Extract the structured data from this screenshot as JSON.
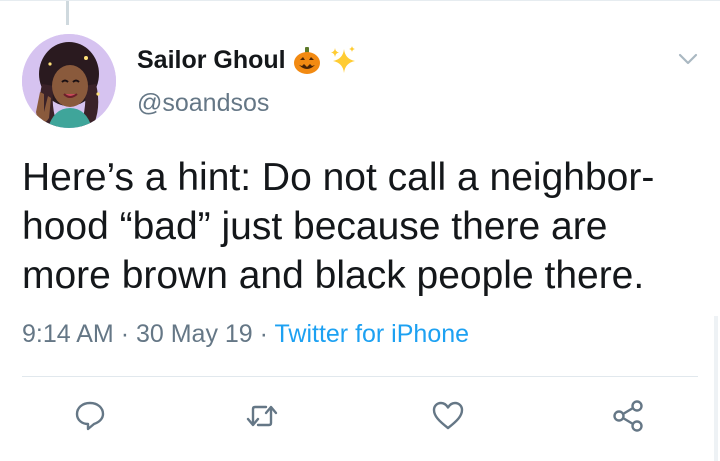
{
  "tweet": {
    "display_name": "Sailor Ghoul",
    "name_emojis": [
      "jack-o-lantern",
      "sparkles"
    ],
    "handle": "@soandsos",
    "text_lines": [
      "Here’s a hint: Do not call a neighbor-",
      "hood “bad” just because there are",
      "more brown and black people there."
    ],
    "time": "9:14 AM",
    "date": "30 May 19",
    "separator": "·",
    "source": "Twitter for iPhone"
  },
  "actions": [
    {
      "icon": "reply-icon"
    },
    {
      "icon": "retweet-icon"
    },
    {
      "icon": "like-icon"
    },
    {
      "icon": "share-icon"
    }
  ],
  "colors": {
    "text": "#14171a",
    "secondary": "#657786",
    "link": "#1da1f2",
    "divider": "#e1e8ed"
  }
}
